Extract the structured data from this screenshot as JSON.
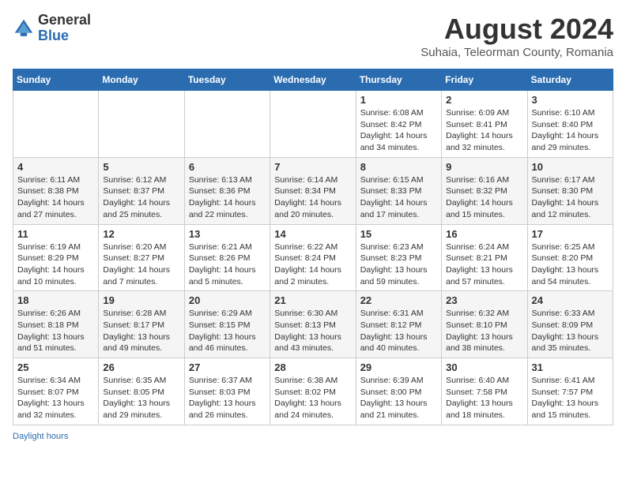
{
  "header": {
    "logo_general": "General",
    "logo_blue": "Blue",
    "month_year": "August 2024",
    "location": "Suhaia, Teleorman County, Romania"
  },
  "days_of_week": [
    "Sunday",
    "Monday",
    "Tuesday",
    "Wednesday",
    "Thursday",
    "Friday",
    "Saturday"
  ],
  "weeks": [
    [
      {
        "day": "",
        "info": ""
      },
      {
        "day": "",
        "info": ""
      },
      {
        "day": "",
        "info": ""
      },
      {
        "day": "",
        "info": ""
      },
      {
        "day": "1",
        "info": "Sunrise: 6:08 AM\nSunset: 8:42 PM\nDaylight: 14 hours\nand 34 minutes."
      },
      {
        "day": "2",
        "info": "Sunrise: 6:09 AM\nSunset: 8:41 PM\nDaylight: 14 hours\nand 32 minutes."
      },
      {
        "day": "3",
        "info": "Sunrise: 6:10 AM\nSunset: 8:40 PM\nDaylight: 14 hours\nand 29 minutes."
      }
    ],
    [
      {
        "day": "4",
        "info": "Sunrise: 6:11 AM\nSunset: 8:38 PM\nDaylight: 14 hours\nand 27 minutes."
      },
      {
        "day": "5",
        "info": "Sunrise: 6:12 AM\nSunset: 8:37 PM\nDaylight: 14 hours\nand 25 minutes."
      },
      {
        "day": "6",
        "info": "Sunrise: 6:13 AM\nSunset: 8:36 PM\nDaylight: 14 hours\nand 22 minutes."
      },
      {
        "day": "7",
        "info": "Sunrise: 6:14 AM\nSunset: 8:34 PM\nDaylight: 14 hours\nand 20 minutes."
      },
      {
        "day": "8",
        "info": "Sunrise: 6:15 AM\nSunset: 8:33 PM\nDaylight: 14 hours\nand 17 minutes."
      },
      {
        "day": "9",
        "info": "Sunrise: 6:16 AM\nSunset: 8:32 PM\nDaylight: 14 hours\nand 15 minutes."
      },
      {
        "day": "10",
        "info": "Sunrise: 6:17 AM\nSunset: 8:30 PM\nDaylight: 14 hours\nand 12 minutes."
      }
    ],
    [
      {
        "day": "11",
        "info": "Sunrise: 6:19 AM\nSunset: 8:29 PM\nDaylight: 14 hours\nand 10 minutes."
      },
      {
        "day": "12",
        "info": "Sunrise: 6:20 AM\nSunset: 8:27 PM\nDaylight: 14 hours\nand 7 minutes."
      },
      {
        "day": "13",
        "info": "Sunrise: 6:21 AM\nSunset: 8:26 PM\nDaylight: 14 hours\nand 5 minutes."
      },
      {
        "day": "14",
        "info": "Sunrise: 6:22 AM\nSunset: 8:24 PM\nDaylight: 14 hours\nand 2 minutes."
      },
      {
        "day": "15",
        "info": "Sunrise: 6:23 AM\nSunset: 8:23 PM\nDaylight: 13 hours\nand 59 minutes."
      },
      {
        "day": "16",
        "info": "Sunrise: 6:24 AM\nSunset: 8:21 PM\nDaylight: 13 hours\nand 57 minutes."
      },
      {
        "day": "17",
        "info": "Sunrise: 6:25 AM\nSunset: 8:20 PM\nDaylight: 13 hours\nand 54 minutes."
      }
    ],
    [
      {
        "day": "18",
        "info": "Sunrise: 6:26 AM\nSunset: 8:18 PM\nDaylight: 13 hours\nand 51 minutes."
      },
      {
        "day": "19",
        "info": "Sunrise: 6:28 AM\nSunset: 8:17 PM\nDaylight: 13 hours\nand 49 minutes."
      },
      {
        "day": "20",
        "info": "Sunrise: 6:29 AM\nSunset: 8:15 PM\nDaylight: 13 hours\nand 46 minutes."
      },
      {
        "day": "21",
        "info": "Sunrise: 6:30 AM\nSunset: 8:13 PM\nDaylight: 13 hours\nand 43 minutes."
      },
      {
        "day": "22",
        "info": "Sunrise: 6:31 AM\nSunset: 8:12 PM\nDaylight: 13 hours\nand 40 minutes."
      },
      {
        "day": "23",
        "info": "Sunrise: 6:32 AM\nSunset: 8:10 PM\nDaylight: 13 hours\nand 38 minutes."
      },
      {
        "day": "24",
        "info": "Sunrise: 6:33 AM\nSunset: 8:09 PM\nDaylight: 13 hours\nand 35 minutes."
      }
    ],
    [
      {
        "day": "25",
        "info": "Sunrise: 6:34 AM\nSunset: 8:07 PM\nDaylight: 13 hours\nand 32 minutes."
      },
      {
        "day": "26",
        "info": "Sunrise: 6:35 AM\nSunset: 8:05 PM\nDaylight: 13 hours\nand 29 minutes."
      },
      {
        "day": "27",
        "info": "Sunrise: 6:37 AM\nSunset: 8:03 PM\nDaylight: 13 hours\nand 26 minutes."
      },
      {
        "day": "28",
        "info": "Sunrise: 6:38 AM\nSunset: 8:02 PM\nDaylight: 13 hours\nand 24 minutes."
      },
      {
        "day": "29",
        "info": "Sunrise: 6:39 AM\nSunset: 8:00 PM\nDaylight: 13 hours\nand 21 minutes."
      },
      {
        "day": "30",
        "info": "Sunrise: 6:40 AM\nSunset: 7:58 PM\nDaylight: 13 hours\nand 18 minutes."
      },
      {
        "day": "31",
        "info": "Sunrise: 6:41 AM\nSunset: 7:57 PM\nDaylight: 13 hours\nand 15 minutes."
      }
    ]
  ],
  "footer": {
    "daylight_hours_label": "Daylight hours"
  }
}
